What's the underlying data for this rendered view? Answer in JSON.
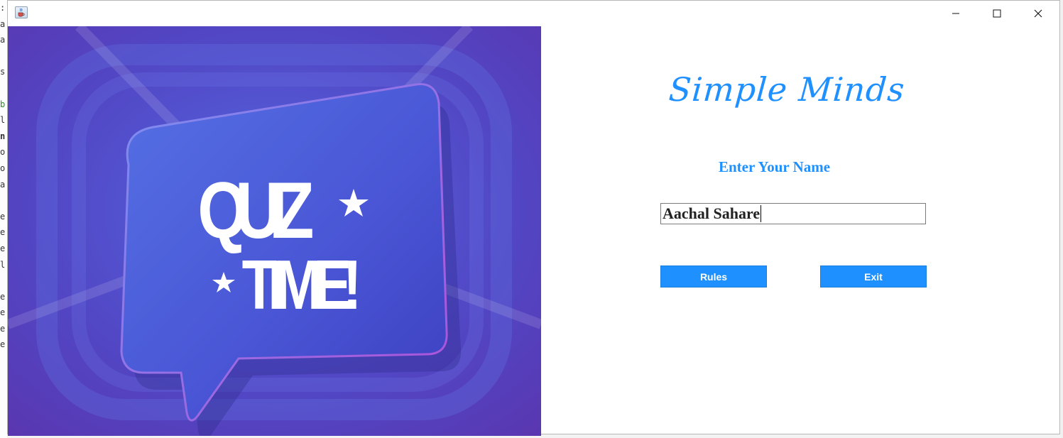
{
  "background_editor": {
    "line_fragments": [
      ":",
      "a",
      "a",
      "",
      "s",
      "",
      "b",
      "l",
      "n",
      "o",
      "o",
      "a",
      "",
      "e",
      "e",
      "e",
      "l",
      "",
      "e",
      "e",
      "e",
      "e"
    ]
  },
  "window": {
    "icon": "java-cup-icon",
    "controls": {
      "minimize_icon": "minimize-icon",
      "maximize_icon": "maximize-icon",
      "close_icon": "close-icon"
    }
  },
  "image": {
    "line1": "QUIZ",
    "line2": "TIME!",
    "colors": {
      "bg": "#5a45c8",
      "bubble": "#4d5fd8",
      "text": "#ffffff"
    }
  },
  "app": {
    "heading": "Simple Minds",
    "name_label": "Enter Your Name",
    "name_value": "Aachal Sahare",
    "rules_button": "Rules",
    "exit_button": "Exit",
    "accent_color": "#1e90ff"
  }
}
